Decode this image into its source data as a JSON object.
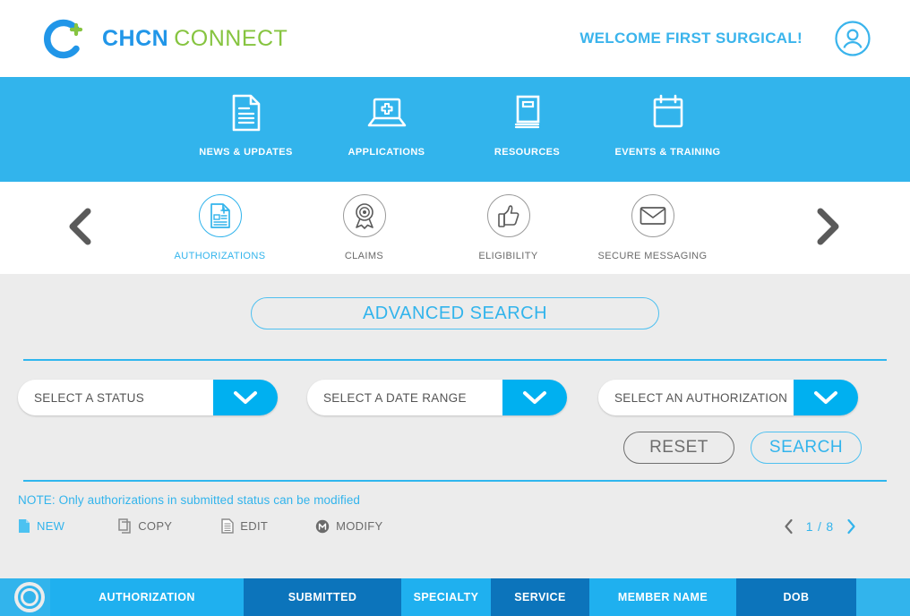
{
  "header": {
    "brand_primary": "CHCN",
    "brand_secondary": "CONNECT",
    "welcome": "WELCOME FIRST SURGICAL!",
    "logo_icon": "chcn-c-plus-logo",
    "avatar_icon": "user-account-icon",
    "brand_blue": "#2196e8",
    "brand_green": "#86c440"
  },
  "primary_nav": {
    "background": "#32b4ec",
    "items": [
      {
        "label": "NEWS & UPDATES",
        "icon": "document-lines-icon"
      },
      {
        "label": "APPLICATIONS",
        "icon": "laptop-medical-cross-icon"
      },
      {
        "label": "RESOURCES",
        "icon": "book-icon"
      },
      {
        "label": "EVENTS & TRAINING",
        "icon": "calendar-icon"
      }
    ]
  },
  "secondary_nav": {
    "prev_icon": "chevron-left-icon",
    "next_icon": "chevron-right-icon",
    "active_color": "#32b4ec",
    "items": [
      {
        "label": "AUTHORIZATIONS",
        "icon": "document-medical-icon",
        "active": true
      },
      {
        "label": "CLAIMS",
        "icon": "award-ribbon-icon",
        "active": false
      },
      {
        "label": "ELIGIBILITY",
        "icon": "thumbs-up-icon",
        "active": false
      },
      {
        "label": "SECURE MESSAGING",
        "icon": "envelope-icon",
        "active": false
      }
    ]
  },
  "search_panel": {
    "advanced_search_label": "ADVANCED SEARCH",
    "filters": [
      {
        "name": "status",
        "value": "SELECT A STATUS",
        "arrow_icon": "chevron-down-icon"
      },
      {
        "name": "date_range",
        "value": "SELECT A DATE RANGE",
        "arrow_icon": "chevron-down-icon"
      },
      {
        "name": "authorization",
        "value": "SELECT AN AUTHORIZATION",
        "arrow_icon": "chevron-down-icon"
      }
    ],
    "reset_label": "RESET",
    "search_label": "SEARCH",
    "accent": "#00b0f0"
  },
  "note": "NOTE: Only authorizations in submitted status can be modified",
  "toolbar": {
    "actions": [
      {
        "label": "NEW",
        "icon": "new-document-icon"
      },
      {
        "label": "COPY",
        "icon": "copy-icon"
      },
      {
        "label": "EDIT",
        "icon": "edit-document-icon"
      },
      {
        "label": "MODIFY",
        "icon": "modify-circle-m-icon"
      }
    ],
    "pager": {
      "prev_icon": "chevron-left-icon",
      "next_icon": "chevron-right-icon",
      "label": "1 / 8"
    }
  },
  "table": {
    "select_all_icon": "radio-select-all-icon",
    "columns": [
      {
        "label": "AUTHORIZATION",
        "shade": "light"
      },
      {
        "label": "SUBMITTED",
        "shade": "dark"
      },
      {
        "label": "SPECIALTY",
        "shade": "light"
      },
      {
        "label": "SERVICE",
        "shade": "dark"
      },
      {
        "label": "MEMBER NAME",
        "shade": "light"
      },
      {
        "label": "DOB",
        "shade": "dark"
      }
    ],
    "rows": []
  }
}
